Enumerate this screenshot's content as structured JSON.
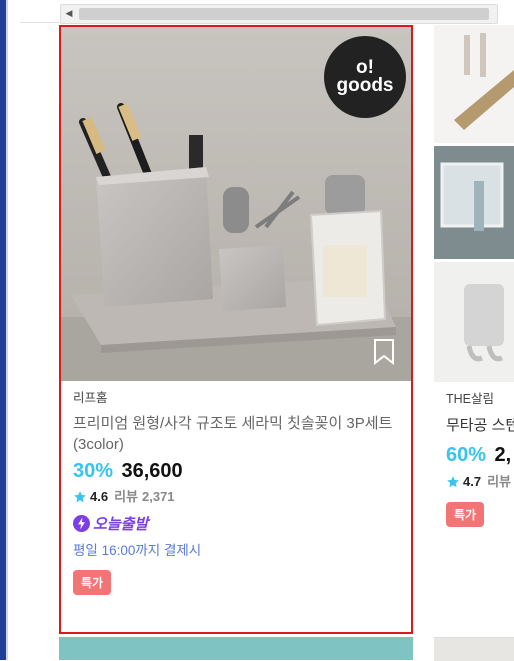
{
  "product": {
    "seller": "리프홈",
    "title": "프리미엄 원형/사각 규조토 세라믹 칫솔꽂이 3P세트(3color)",
    "discount": "30%",
    "price": "36,600",
    "rating": "4.6",
    "review_label": "리뷰",
    "review_count": "2,371",
    "delivery_badge": "오늘출발",
    "delivery_note": "평일 16:00까지 결제시",
    "special_badge": "특가",
    "brand_badge_line1": "o!",
    "brand_badge_line2": "goods"
  },
  "next_product": {
    "seller": "THE살림",
    "title": "무타공 스텐",
    "discount": "60%",
    "price": "2,",
    "rating": "4.7",
    "review_label": "리뷰",
    "special_badge": "특가"
  },
  "colors": {
    "accent": "#35c5f0",
    "selection_border": "#d81b1b",
    "special_badge": "#f27474",
    "today_badge": "#7b3fe4",
    "delivery_note": "#5a7bd8"
  },
  "icons": [
    "star-icon",
    "lightning-icon",
    "bookmark-icon",
    "scroll-left-arrow-icon"
  ]
}
